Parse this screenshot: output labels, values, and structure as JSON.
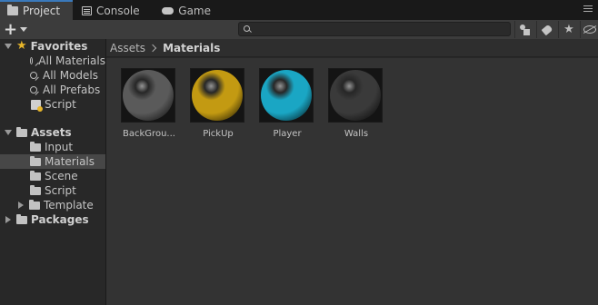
{
  "tabs": [
    {
      "label": "Project",
      "icon": "folder-icon"
    },
    {
      "label": "Console",
      "icon": "console-icon"
    },
    {
      "label": "Game",
      "icon": "gamepad-icon"
    }
  ],
  "toolbar": {
    "create_label": "+",
    "search_value": "",
    "buttons": [
      "filter-by-type-icon",
      "filter-by-label-icon",
      "favorites-star-icon",
      "hidden-packages-icon"
    ]
  },
  "tree": {
    "favorites": {
      "label": "Favorites",
      "items": [
        "All Materials",
        "All Models",
        "All Prefabs",
        "Script"
      ]
    },
    "assets": {
      "label": "Assets",
      "items": [
        "Input",
        "Materials",
        "Scene",
        "Script",
        "Template"
      ],
      "selected": "Materials"
    },
    "packages": {
      "label": "Packages"
    }
  },
  "breadcrumb": {
    "root": "Assets",
    "current": "Materials"
  },
  "materials": [
    {
      "name": "BackGrou...",
      "color": "#5a5a5a"
    },
    {
      "name": "PickUp",
      "color": "#c39a12"
    },
    {
      "name": "Player",
      "color": "#1aa6c4"
    },
    {
      "name": "Walls",
      "color": "#3a3a3a"
    }
  ],
  "colors": {
    "favorite_star": "#e7b52a",
    "accent": "#3a79bb"
  }
}
